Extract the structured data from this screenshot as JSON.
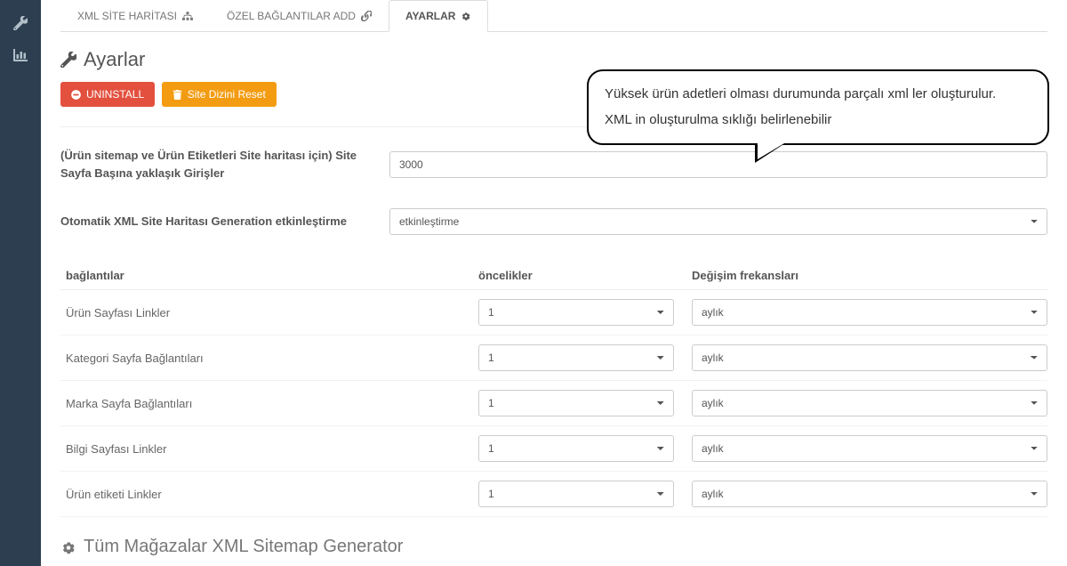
{
  "tabs": [
    {
      "label": "XML SİTE HARİTASI",
      "icon": "sitemap"
    },
    {
      "label": "ÖZEL BAĞLANTILAR ADD",
      "icon": "link"
    },
    {
      "label": "AYARLAR",
      "icon": "cogs"
    }
  ],
  "activeTab": 2,
  "title": "Ayarlar",
  "buttons": {
    "uninstall": "UNINSTALL",
    "reset": "Site Dizini Reset"
  },
  "callout": {
    "line1": "Yüksek ürün adetleri olması durumunda parçalı xml ler oluşturulur.",
    "line2": "XML in oluşturulma sıklığı belirlenebilir"
  },
  "form": {
    "entries_label": "(Ürün sitemap ve Ürün Etiketleri Site haritası için) Site Sayfa Başına yaklaşık Girişler",
    "entries_value": "3000",
    "auto_label": "Otomatik XML Site Haritası Generation etkinleştirme",
    "auto_value": "etkinleştirme"
  },
  "table": {
    "head": {
      "links": "bağlantılar",
      "priority": "öncelikler",
      "freq": "Değişim frekansları"
    },
    "rows": [
      {
        "name": "Ürün Sayfası Linkler",
        "priority": "1",
        "freq": "aylık"
      },
      {
        "name": "Kategori Sayfa Bağlantıları",
        "priority": "1",
        "freq": "aylık"
      },
      {
        "name": "Marka Sayfa Bağlantıları",
        "priority": "1",
        "freq": "aylık"
      },
      {
        "name": "Bilgi Sayfası Linkler",
        "priority": "1",
        "freq": "aylık"
      },
      {
        "name": "Ürün etiketi Linkler",
        "priority": "1",
        "freq": "aylık"
      }
    ]
  },
  "subtitle": "Tüm Mağazalar XML Sitemap Generator"
}
